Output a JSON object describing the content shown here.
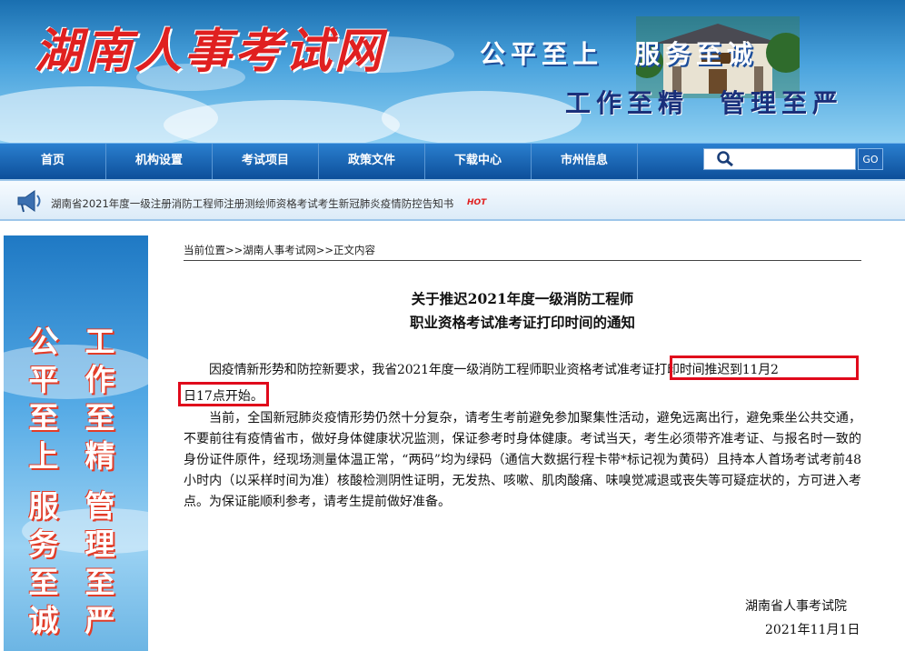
{
  "header": {
    "site_title": "湖南人事考试网",
    "slogan_line1": "公平至上　服务至诚",
    "slogan_line2": "工作至精　管理至严"
  },
  "nav": {
    "items": [
      "首页",
      "机构设置",
      "考试项目",
      "政策文件",
      "下载中心",
      "市州信息"
    ],
    "search_placeholder": "",
    "go_label": "GO"
  },
  "ticker": {
    "text": "湖南省2021年度一级注册消防工程师注册测绘师资格考试考生新冠肺炎疫情防控告知书",
    "badge": "HOT"
  },
  "side_banner": {
    "col1": "公平至上",
    "col2": "工作至精",
    "col3": "服务至诚",
    "col4": "管理至严"
  },
  "breadcrumb": {
    "text": "当前位置>>湖南人事考试网>>正文内容"
  },
  "article": {
    "title_line1": "关于推迟2021年度一级消防工程师",
    "title_line2": "职业资格考试准考证打印时间的通知",
    "para1_line1": "因疫情新形势和防控新要求，我省2021年度一级消防工程师职业资格考试准考证打印时间推迟到11月2",
    "para1_line2": "日17点开始。",
    "para2": "当前，全国新冠肺炎疫情形势仍然十分复杂，请考生考前避免参加聚集性活动，避免远离出行，避免乘坐公共交通，不要前往有疫情省市，做好身体健康状况监测，保证参考时身体健康。考试当天，考生必须带齐准考证、与报名时一致的身份证件原件，经现场测量体温正常，“两码”均为绿码（通信大数据行程卡带*标记视为黄码）且持本人首场考试考前48小时内（以采样时间为准）核酸检测阴性证明，无发热、咳嗽、肌肉酸痛、味嗅觉减退或丧失等可疑症状的，方可进入考点。为保证能顺利参考，请考生提前做好准备。",
    "signature_org": "湖南省人事考试院",
    "signature_date": "2021年11月1日"
  },
  "colors": {
    "nav_bg": "#0d4f9a",
    "highlight": "#e0091b",
    "title_red": "#e02020"
  }
}
